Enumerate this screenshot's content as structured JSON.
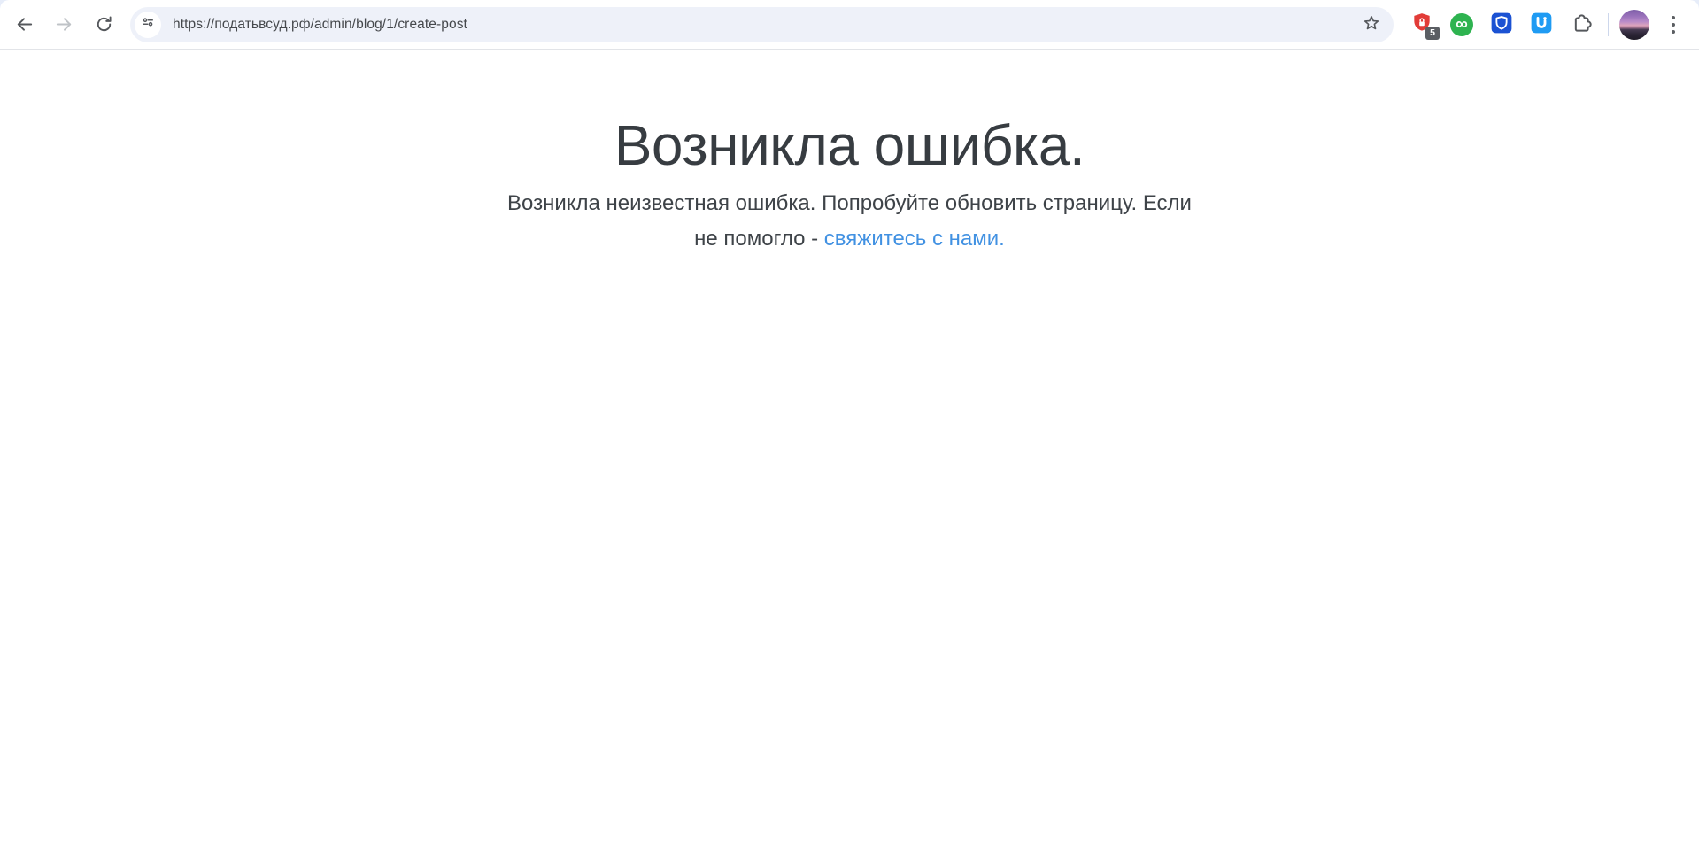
{
  "browser": {
    "url": "https://податьвсуд.рф/admin/blog/1/create-post",
    "extensions": {
      "adguard_badge": "5",
      "infinity_glyph": "∞"
    }
  },
  "page": {
    "title": "Возникла ошибка.",
    "message_line1": "Возникла неизвестная ошибка. Попробуйте обновить страницу. Если",
    "message_line2_prefix": "не помогло - ",
    "link_text": "свяжитесь с нами."
  },
  "colors": {
    "link_blue": "#4191e2",
    "adguard_red": "#e23c38",
    "infinity_green": "#2eb350",
    "bitwarden_blue": "#1b52d3",
    "u_icon_blue": "#1f9bf3",
    "omnibox_bg": "#eef1f9",
    "toolbar_icon_gray": "#55585c",
    "text_dark": "#373c41"
  }
}
